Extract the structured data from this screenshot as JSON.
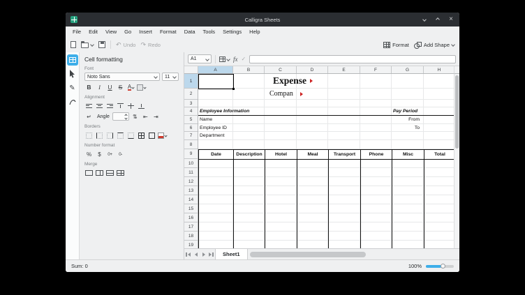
{
  "window": {
    "title": "Calligra Sheets"
  },
  "menubar": [
    "File",
    "Edit",
    "View",
    "Go",
    "Insert",
    "Format",
    "Data",
    "Tools",
    "Settings",
    "Help"
  ],
  "toolbar": {
    "undo": "Undo",
    "redo": "Redo",
    "format": "Format",
    "add_shape": "Add Shape"
  },
  "formula_bar": {
    "cell_ref": "A1",
    "fx_label": "fx",
    "input_value": ""
  },
  "sidebar": {
    "title": "Cell formatting",
    "font_label": "Font",
    "font_family": "Noto Sans",
    "font_size": "11",
    "alignment_label": "Alignment",
    "angle_label": "Angle",
    "angle_value": "",
    "borders_label": "Borders",
    "number_format_label": "Number format",
    "merge_label": "Merge",
    "char_buttons": [
      "bold",
      "italic",
      "underline",
      "strikethrough",
      "font-color",
      "background-color"
    ],
    "align_buttons": [
      "align-left",
      "align-center",
      "align-right",
      "valign-top",
      "valign-middle",
      "valign-bottom"
    ],
    "align_buttons2_pre": [
      "wrap-text"
    ],
    "align_buttons2_post": [
      "vertical-text",
      "indent-decrease",
      "indent-increase"
    ],
    "border_buttons": [
      "border-none",
      "border-left",
      "border-right",
      "border-top",
      "border-bottom",
      "border-all",
      "border-outline",
      "border-color"
    ],
    "number_buttons": [
      "percent",
      "money",
      "increase-precision",
      "decrease-precision"
    ],
    "merge_buttons": [
      "merge-cells",
      "merge-horizontal",
      "merge-vertical",
      "unmerge-cells"
    ]
  },
  "sheet": {
    "columns": [
      "A",
      "B",
      "C",
      "D",
      "E",
      "F",
      "G",
      "H"
    ],
    "rows": [
      "1",
      "2",
      "3",
      "4",
      "5",
      "6",
      "7",
      "8",
      "9",
      "10",
      "11",
      "12",
      "13",
      "14",
      "15",
      "16",
      "17",
      "18",
      "19"
    ],
    "selected_cell": "A1",
    "selected_column": "A",
    "selected_row": "1",
    "cells": {
      "title": "Expense",
      "subtitle": "Compan",
      "employee_info": "Employee Information",
      "pay_period": "Pay Period",
      "name": "Name",
      "from": "From",
      "employee_id": "Employee ID",
      "to": "To",
      "department": "Department"
    },
    "table_columns": [
      "Date",
      "Description",
      "Hotel",
      "Meal",
      "Transport",
      "Phone",
      "Misc",
      "Total"
    ]
  },
  "tab_bar": {
    "sheet": "Sheet1"
  },
  "status_bar": {
    "sum": "Sum: 0",
    "zoom": "100%"
  },
  "colors": {
    "accent": "#3daee9",
    "titlebar": "#2b2e32",
    "overflow_marker": "#cc2222"
  }
}
